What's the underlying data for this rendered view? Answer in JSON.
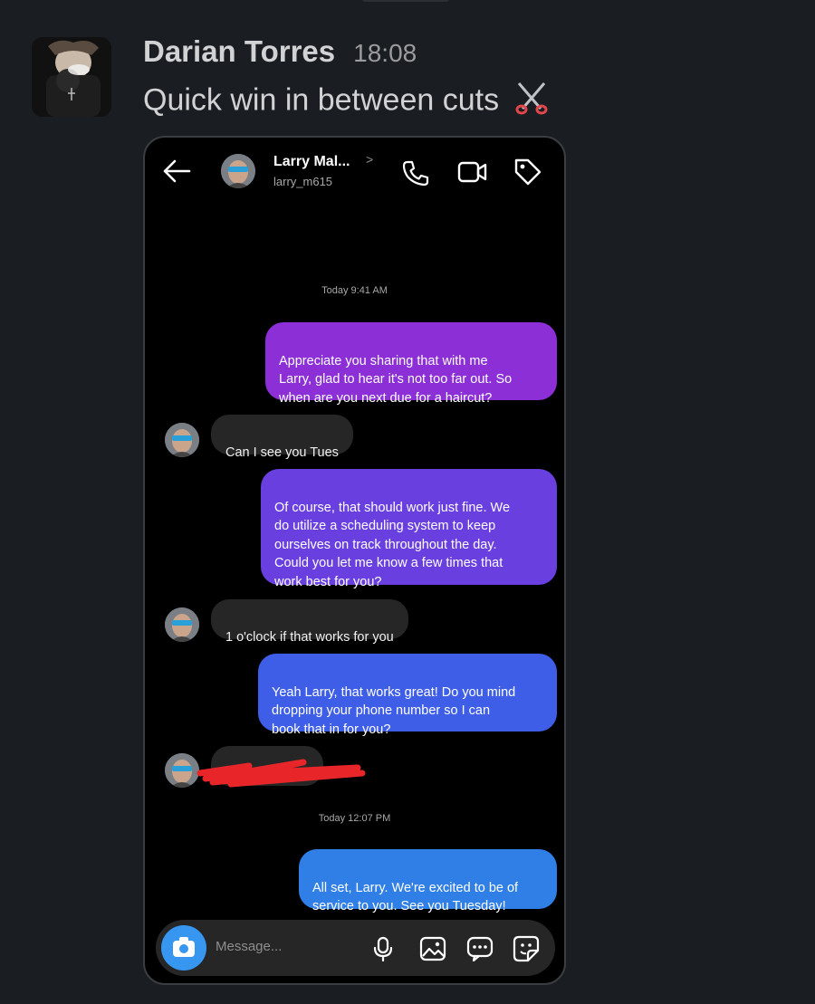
{
  "message": {
    "author": "Darian Torres",
    "time": "18:08",
    "text": "Quick win in between cuts"
  },
  "dm": {
    "contact_name": "Larry Mal...",
    "contact_chevron": ">",
    "contact_handle": "larry_m615",
    "timestamps": [
      "Today 9:41 AM",
      "Today 12:07 PM"
    ],
    "messages": [
      {
        "from": "me",
        "text": "Appreciate you sharing that with me\nLarry, glad to hear it's not too far out. So\nwhen are you next due for a haircut?",
        "color": "#8c2fd6"
      },
      {
        "from": "them",
        "text": "Can I see you Tues"
      },
      {
        "from": "me",
        "text": "Of course, that should work just fine. We\ndo utilize a scheduling system to keep\nourselves on track throughout the day.\nCould you let me know a few times that\nwork best for you?",
        "color": "#6a3fe0"
      },
      {
        "from": "them",
        "text": "1 o'clock if that works for you"
      },
      {
        "from": "me",
        "text": "Yeah Larry, that works great! Do you mind\ndropping your phone number so I can\nbook that in for you?",
        "color": "#3f5ee8"
      },
      {
        "from": "them",
        "text": "",
        "redacted": true
      },
      {
        "from": "me",
        "text": "All set, Larry. We're excited to be of\nservice to you. See you Tuesday!",
        "color": "#2f7fe6"
      }
    ],
    "composer_placeholder": "Message..."
  },
  "colors": {
    "background": "#1a1d21",
    "redaction": "#e8262a",
    "camera_button": "#3797f0"
  }
}
